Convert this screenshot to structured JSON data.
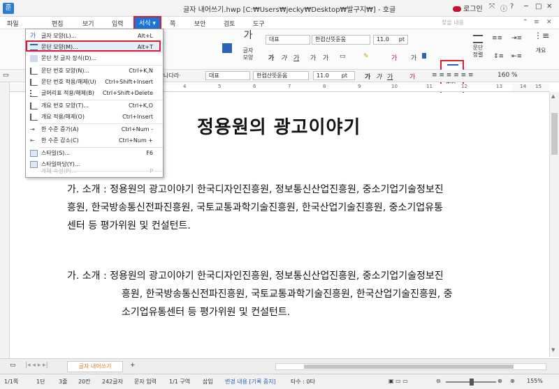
{
  "window": {
    "title": "글자 내어쓰기.hwp [C:₩Users₩jecky₩Desktop₩발구지₩] - 호글",
    "app_icon": "hangul-app-icon",
    "login_label": "로그인",
    "controls": [
      "⤧",
      "ⓘ",
      "?",
      "─",
      "□",
      "✕"
    ]
  },
  "menubar": {
    "file": "파일",
    "items": [
      "편집",
      "보기",
      "입력",
      "서식",
      "쪽",
      "보안",
      "검토",
      "도구"
    ],
    "active": "서식",
    "help_search": "찾을 내용",
    "ribbon_controls": [
      "⌃",
      "≡",
      "✕"
    ]
  },
  "ribbon": {
    "char_shape_label": "글자\n모양",
    "style_value": "대표",
    "font_value": "한컴산뜻돋움",
    "size_value": "11.0",
    "size_unit": "pt",
    "para_shape_label": "문단\n모양",
    "para_align_label": "문단\n정렬",
    "style_right": "개요"
  },
  "fmtbar": {
    "font_family_right": "한컴산뜻돋움",
    "size_value": "11.0",
    "size_unit": "pt",
    "style_value": "대표",
    "font_prefix": "나다라·"
  },
  "ruler": {
    "numbers": [
      "4",
      "5",
      "6",
      "7",
      "8",
      "9",
      "10",
      "11",
      "12",
      "13",
      "14",
      "15"
    ]
  },
  "dropdown": {
    "items": [
      {
        "icon": "char-shape-icon",
        "label": "글자 모양(L)...",
        "shortcut": "Alt+L",
        "disabled": false
      },
      {
        "icon": "para-shape-icon",
        "label": "문단 모양(M)...",
        "shortcut": "Alt+T",
        "disabled": false,
        "highlight": true
      },
      {
        "icon": "drop-cap-icon",
        "label": "문단 첫 글자 장식(D)...",
        "shortcut": "",
        "disabled": false
      },
      {
        "icon": "para-number-icon",
        "label": "문단 번호 모양(N)...",
        "shortcut": "Ctrl+K,N",
        "disabled": false
      },
      {
        "icon": "para-number-apply-icon",
        "label": "문단 번호 적용/해제(U)",
        "shortcut": "Ctrl+Shift+Insert",
        "disabled": false
      },
      {
        "icon": "bullet-icon",
        "label": "글머리표 적용/해제(B)",
        "shortcut": "Ctrl+Shift+Delete",
        "disabled": false
      },
      {
        "icon": "outline-number-icon",
        "label": "개요 번호 모양(T)...",
        "shortcut": "Ctrl+K,O",
        "disabled": false
      },
      {
        "icon": "outline-apply-icon",
        "label": "개요 적용/해제(O)",
        "shortcut": "Ctrl+Insert",
        "disabled": false
      },
      {
        "icon": "level-up-icon",
        "label": "한 수준 증가(A)",
        "shortcut": "Ctrl+Num -",
        "disabled": false
      },
      {
        "icon": "level-down-icon",
        "label": "한 수준 감소(C)",
        "shortcut": "Ctrl+Num +",
        "disabled": false
      },
      {
        "icon": "style-icon",
        "label": "스타일(S)...",
        "shortcut": "F6",
        "disabled": false
      },
      {
        "icon": "style-gallery-icon",
        "label": "스타일마당(Y)...",
        "shortcut": "",
        "disabled": false
      },
      {
        "icon": "object-props-icon",
        "label": "개체 속성(P)...",
        "shortcut": "P",
        "disabled": true
      }
    ]
  },
  "document": {
    "title": "정용원의 광고이야기",
    "para1": [
      "가. 소개 : 정용원의 광고이야기 한국디자인진흥원, 정보통신산업진흥원, 중소기업기술정보진",
      "흥원, 한국방송통신전파진흥원, 국토교통과학기술진흥원, 한국산업기술진흥원, 중소기업유통",
      "센터 등 평가위원 및 컨설턴트."
    ],
    "para2_first": "가. 소개 : 정용원의 광고이야기 한국디자인진흥원, 정보통신산업진흥원, 중소기업기술정보진",
    "para2_rest": [
      "흥원, 한국방송통신전파진흥원, 국토교통과학기술진흥원, 한국산업기술진흥원, 중",
      "소기업유통센터 등 평가위원 및 컨설턴트."
    ]
  },
  "tabbar": {
    "tab_label": "글자 내어쓰기",
    "add_tab": "+"
  },
  "statusbar": {
    "page": "1/1쪽",
    "column": "1단",
    "line": "3줄",
    "char_col": "20칸",
    "char_count": "242글자",
    "input_mode": "문자 입력",
    "section": "1/1 구역",
    "insert": "삽입",
    "track_changes": "변경 내용 [기록 중지]",
    "typo": "타수 : 0타",
    "zoom": "155%"
  }
}
